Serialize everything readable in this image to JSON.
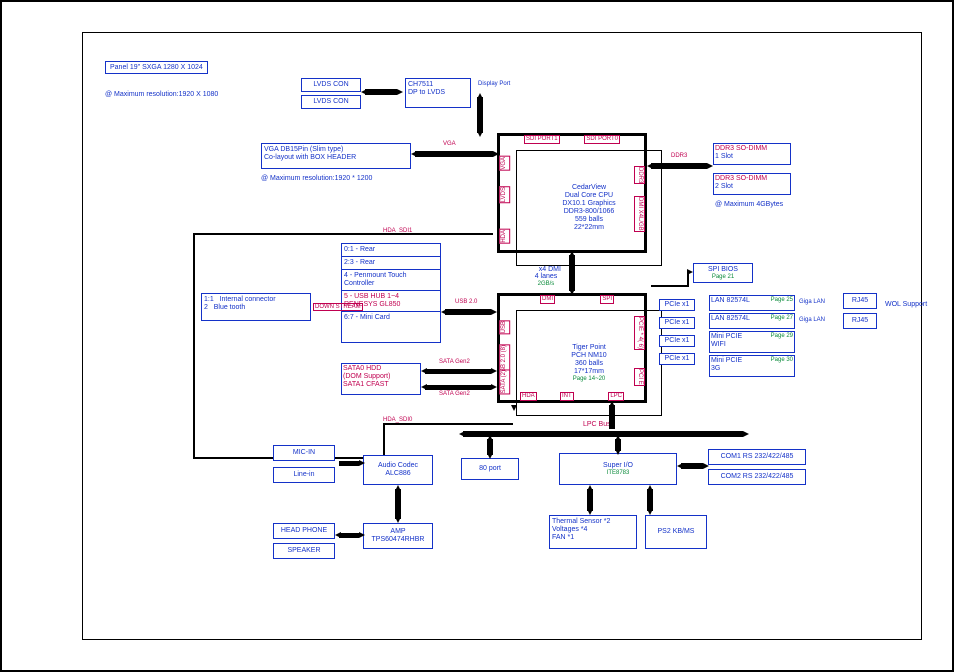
{
  "panel_note": "Panel 19\" SXGA 1280 X 1024",
  "max_res1": "@ Maximum resolution:1920 X 1080",
  "cpu": {
    "l1": "CedarView",
    "l2": "Dual Core CPU",
    "l3": "DX10.1 Graphics",
    "l4": "DDR3-800/1066",
    "l5": "559 balls",
    "l6": "22*22mm"
  },
  "pch": {
    "l1": "Tiger Point",
    "l2": "PCH NM10",
    "l3": "360 balls",
    "l4": "17*17mm",
    "pg": "Page 14~20"
  },
  "lvds_con": "LVDS CON",
  "ch7511": {
    "l1": "CH7511",
    "l2": "DP to LVDS",
    "port": "Display Port"
  },
  "vga": {
    "l1": "VGA DB15Pin (Slim type)",
    "l2": "Co-layout with BOX HEADER"
  },
  "vga_max": "@ Maximum resolution:1920 * 1200",
  "ddr": {
    "a": {
      "l1": "DDR3 SO-DIMM",
      "l2": "1 Slot"
    },
    "b": {
      "l1": "DDR3 SO-DIMM",
      "l2": "2 Slot"
    }
  },
  "ddr_note": "@ Maximum 4GBytes",
  "usb": {
    "r1": "0:1 - Rear",
    "r2": "2:3 - Rear",
    "r3": "4 - Penmount Touch",
    "r4": "Controller",
    "r5": "5 - USB HUB 1~4",
    "r6": "RENESYS GL850",
    "r7": "6:7 - Mini Card"
  },
  "usb_down": "DOWN STREAM",
  "usb20": "USB 2.0",
  "leftbar": {
    "a": "1:1   Internal connector",
    "b": "2   Blue tooth"
  },
  "sata": {
    "a": "SATA0 HDD",
    "b": "(DOM Support)",
    "c": "SATA1 CFAST"
  },
  "sata_g1": "SATA Gen2",
  "sata_g2": "SATA Gen2",
  "spi": {
    "t": "SPI BIOS",
    "pg": "Page 21"
  },
  "lan1": {
    "t": "LAN 82574L",
    "pg": "Page 25"
  },
  "lan2": {
    "t": "LAN 82574L",
    "pg": "Page 27"
  },
  "mpcie1": {
    "t": "Mini PCIE",
    "sub": "WIFI",
    "pg": "Page 29"
  },
  "mpcie2": {
    "t": "Mini PCIE",
    "sub": "3G",
    "pg": "Page 30"
  },
  "rj45a": "RJ45",
  "rj45b": "RJ45",
  "gigalan": "Giga LAN",
  "wol": "WOL Support",
  "pcie": "PCIe x1",
  "dmi": {
    "l1": "x4 DMI",
    "l2": "4 lanes",
    "l3": "2GB/s"
  },
  "lpc_bus": "LPC Bus",
  "port80": "80 port",
  "sio": {
    "l1": "Super I/O",
    "l2": "ITE8783"
  },
  "com1": "COM1 RS 232/422/485",
  "com2": "COM2 RS 232/422/485",
  "therm": {
    "l1": "Thermal Sensor *2",
    "l2": "Voltages *4",
    "l3": "FAN *1"
  },
  "ps2": "PS2 KB/MS",
  "codec": {
    "l1": "Audio Codec",
    "l2": "ALC886"
  },
  "amp": {
    "l1": "AMP",
    "l2": "TPS60474RHBR"
  },
  "micin": "MIC-IN",
  "linein": "Line-in",
  "hp": "HEAD PHONE",
  "spk": "SPEAKER",
  "hda_sdi1": "HDA_SDI1",
  "hda_sdi0": "HDA_SDI0",
  "cpu_ports": {
    "t1": "SDI PORT1",
    "t2": "SDI PORT0",
    "l1": "VGA",
    "l2": "LVDS",
    "l3": "HDA",
    "b1": "",
    "r1": "DDR3",
    "r2": "DMI X4L/GB"
  },
  "pch_ports": {
    "t1": "DMI",
    "t2": "SPI",
    "l1": "USB",
    "l2": "USB 2.0 (8)",
    "l3": "SATA (2)",
    "r1": "PCIE * 4( 6)",
    "r2": "PCI E",
    "b1": "HDA",
    "b2": "INT",
    "b3": "LPC"
  }
}
